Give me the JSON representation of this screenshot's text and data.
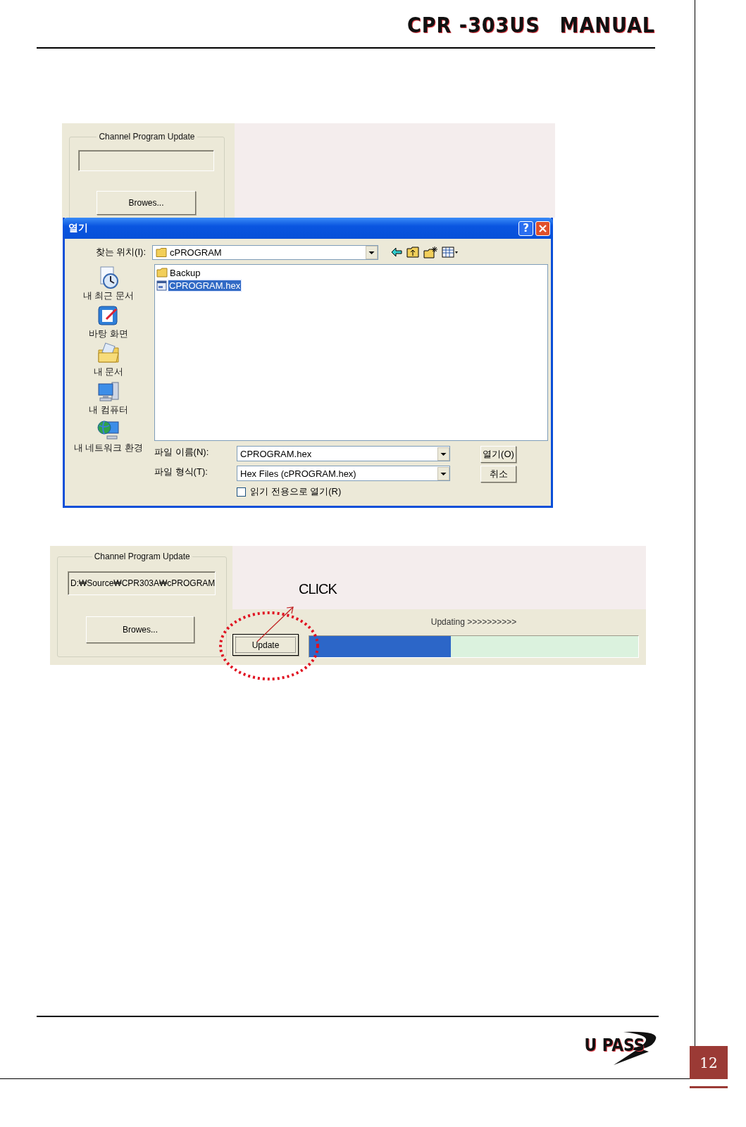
{
  "header": {
    "product": "CPR -303US",
    "title": "MANUAL"
  },
  "screenshot_1": {
    "panel": {
      "group_title": "Channel Program Update",
      "browse_button": "Browes..."
    },
    "dialog": {
      "title": "열기",
      "help_button": "?",
      "look_in_label": "찾는 위치(I):",
      "look_in_value": "cPROGRAM",
      "places": [
        {
          "label": "내 최근 문서",
          "kind": "recent"
        },
        {
          "label": "바탕 화면",
          "kind": "desktop"
        },
        {
          "label": "내 문서",
          "kind": "documents"
        },
        {
          "label": "내 컴퓨터",
          "kind": "computer"
        },
        {
          "label": "내 네트워크 환경",
          "kind": "network"
        }
      ],
      "files": [
        {
          "name": "Backup",
          "kind": "folder",
          "selected": false
        },
        {
          "name": "CPROGRAM.hex",
          "kind": "file",
          "selected": true
        }
      ],
      "filename_label": "파일 이름(N):",
      "filename_value": "CPROGRAM.hex",
      "filetype_label": "파일 형식(T):",
      "filetype_value": "Hex Files (cPROGRAM.hex)",
      "read_only": {
        "label": "읽기 전용으로 열기(R)",
        "checked": false
      },
      "open_button": "열기(O)",
      "cancel_button": "취소"
    }
  },
  "screenshot_2": {
    "group_title": "Channel Program Update",
    "path_value": "D:₩Source₩CPR303A₩cPROGRAM",
    "browse_button": "Browes...",
    "update_button": "Update",
    "status": "Updating >>>>>>>>>>",
    "progress": {
      "level": 0.43
    },
    "annotation": "CLICK"
  },
  "footer": {
    "logo": "U PASS",
    "page_number": "12"
  }
}
